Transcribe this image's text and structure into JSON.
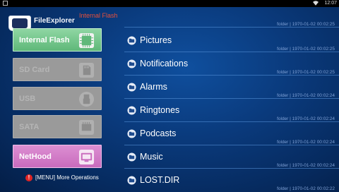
{
  "status_bar": {
    "time": "12:07",
    "wifi_icon": "wifi-icon"
  },
  "header": {
    "app_title": "FileExplorer",
    "current_path": "Internal Flash"
  },
  "storage": [
    {
      "label": "Internal Flash",
      "state": "active",
      "icon": "flash-chip-icon"
    },
    {
      "label": "SD Card",
      "state": "disabled",
      "icon": "sd-card-icon"
    },
    {
      "label": "USB",
      "state": "disabled",
      "icon": "usb-icon"
    },
    {
      "label": "SATA",
      "state": "disabled",
      "icon": "sata-icon"
    },
    {
      "label": "NetHood",
      "state": "active",
      "icon": "network-icon"
    }
  ],
  "menu_hint": "[MENU] More Operations",
  "top_partial_meta": "folder | 1970-01-02 00:02:25",
  "files": [
    {
      "name": "Pictures",
      "meta": "folder | 1970-01-02 00:02:25"
    },
    {
      "name": "Notifications",
      "meta": "folder | 1970-01-02 00:02:25"
    },
    {
      "name": "Alarms",
      "meta": "folder | 1970-01-02 00:02:24"
    },
    {
      "name": "Ringtones",
      "meta": "folder | 1970-01-02 00:02:24"
    },
    {
      "name": "Podcasts",
      "meta": "folder | 1970-01-02 00:02:24"
    },
    {
      "name": "Music",
      "meta": "folder | 1970-01-02 00:02:24"
    },
    {
      "name": "LOST.DIR",
      "meta": "folder | 1970-01-02 00:02:22"
    }
  ],
  "colors": {
    "internal_flash": "#7bc98f",
    "nethood": "#d57fcb",
    "disabled": "#9a9a9a",
    "path_text": "#e8503a"
  }
}
